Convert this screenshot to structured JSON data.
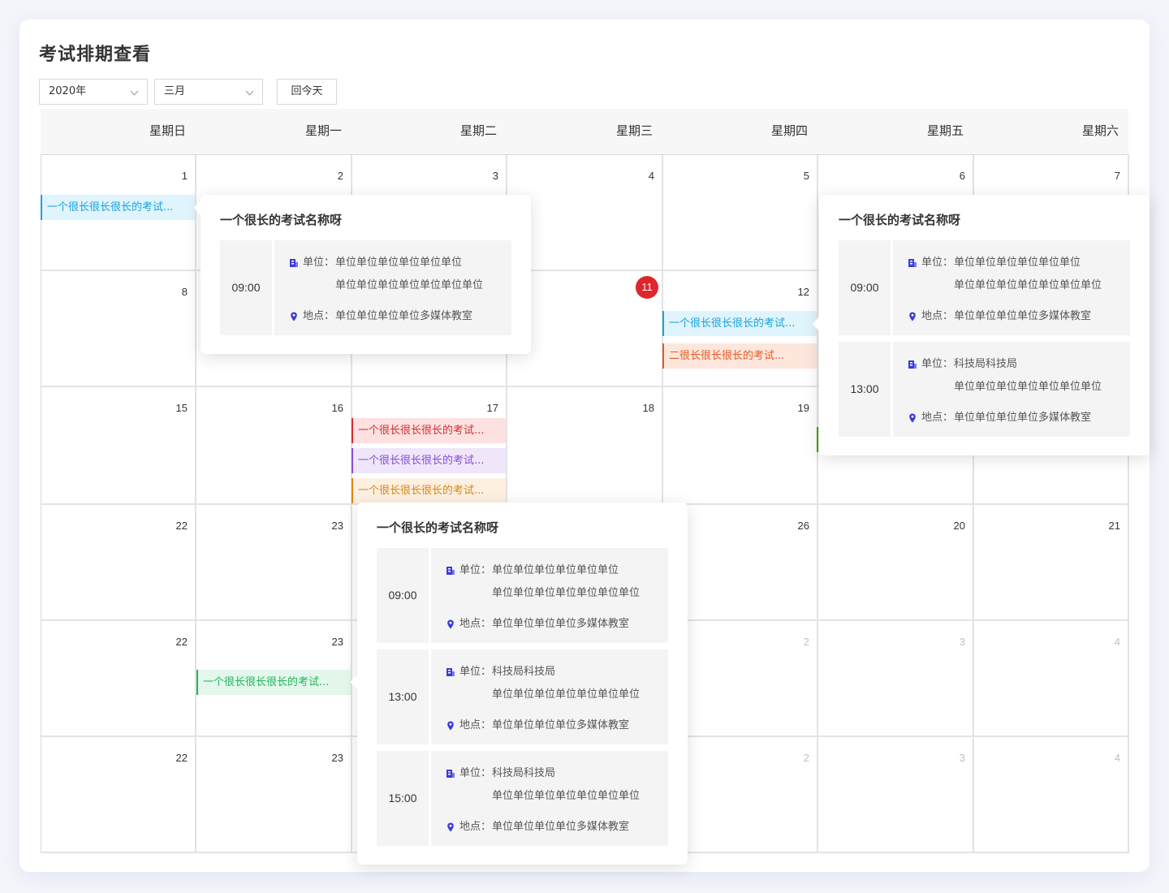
{
  "page": {
    "title": "考试排期查看"
  },
  "controls": {
    "year": "2020年",
    "month": "三月",
    "today_button": "回今天"
  },
  "weekdays": [
    "星期日",
    "星期一",
    "星期二",
    "星期三",
    "星期四",
    "星期五",
    "星期六"
  ],
  "weeks": [
    [
      "1",
      "2",
      "3",
      "4",
      "5",
      "6",
      "7"
    ],
    [
      "8",
      "",
      "",
      "11",
      "12",
      "",
      ""
    ],
    [
      "15",
      "16",
      "17",
      "18",
      "19",
      "",
      ""
    ],
    [
      "22",
      "23",
      "",
      "",
      "26",
      "20",
      "21"
    ],
    [
      "22",
      "23",
      "",
      "",
      "2",
      "3",
      "4"
    ],
    [
      "22",
      "23",
      "",
      "",
      "2",
      "3",
      "4"
    ]
  ],
  "muted_days": [
    "5-4",
    "5-5",
    "5-6",
    "6-4",
    "6-5",
    "6-6"
  ],
  "today_day": "11",
  "events": {
    "e1": "一个很长很长很长的考试...",
    "e2": "一个很长很长很长的考试...",
    "e3": "二很长很长很长的考试...",
    "e4": "一个很长很长很长的考试...",
    "e5": "一个很长很长很长的考试...",
    "e6": "一个很长很长很长的考试...",
    "e7": "一个很长很长很长的考试..."
  },
  "labels": {
    "unit": "单位：",
    "place": "地点："
  },
  "popovers": {
    "p1": {
      "title": "一个很长的考试名称呀",
      "slots": [
        {
          "time": "09:00",
          "unit1": "单位单位单位单位单位单位",
          "unit2": "单位单位单位单位单位单位单位",
          "place": "单位单位单位单位多媒体教室"
        }
      ]
    },
    "p2": {
      "title": "一个很长的考试名称呀",
      "slots": [
        {
          "time": "09:00",
          "unit1": "单位单位单位单位单位单位",
          "unit2": "单位单位单位单位单位单位单位",
          "place": "单位单位单位单位多媒体教室"
        },
        {
          "time": "13:00",
          "unit1": "科技局科技局",
          "unit2": "单位单位单位单位单位单位单位",
          "place": "单位单位单位单位多媒体教室"
        }
      ]
    },
    "p3": {
      "title": "一个很长的考试名称呀",
      "slots": [
        {
          "time": "09:00",
          "unit1": "单位单位单位单位单位单位",
          "unit2": "单位单位单位单位单位单位单位",
          "place": "单位单位单位单位多媒体教室"
        },
        {
          "time": "13:00",
          "unit1": "科技局科技局",
          "unit2": "单位单位单位单位单位单位单位",
          "place": "单位单位单位单位多媒体教室"
        },
        {
          "time": "15:00",
          "unit1": "科技局科技局",
          "unit2": "单位单位单位单位单位单位单位",
          "place": "单位单位单位单位多媒体教室"
        }
      ]
    }
  },
  "colors": {
    "accent_today": "#e0252b",
    "event_blue": "#1aa3dc",
    "event_orange": "#e55a24",
    "event_red": "#d42f2f",
    "event_purple": "#8a4cd6",
    "event_amber": "#d98616",
    "event_green": "#22b55a",
    "icon_blue": "#3b3bdc"
  },
  "icons": {
    "unit": "building-icon",
    "place": "location-pin-icon",
    "dropdown": "chevron-down-icon"
  }
}
